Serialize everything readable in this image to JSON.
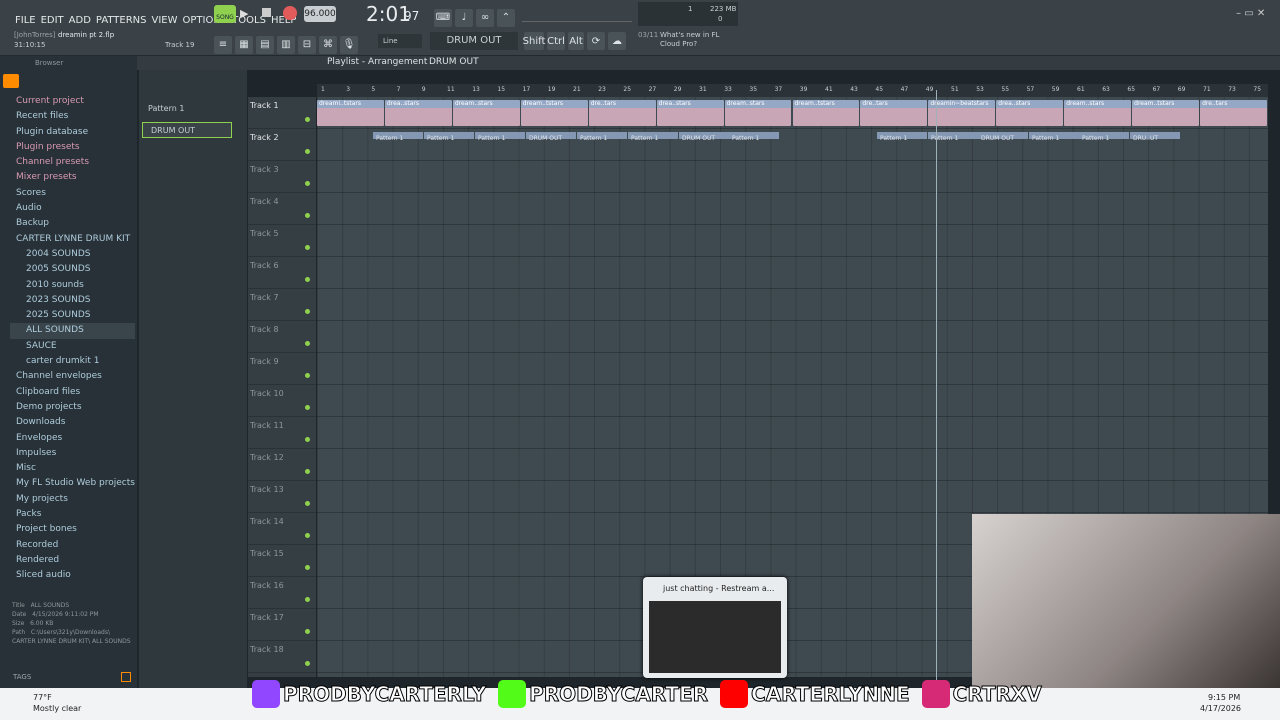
{
  "menu": [
    "FILE",
    "EDIT",
    "ADD",
    "PATTERNS",
    "VIEW",
    "OPTIONS",
    "TOOLS",
    "HELP"
  ],
  "transport": {
    "mode": "SONG",
    "tempo": "96.000",
    "time": "2:01",
    "time_ms": "97",
    "cpu": "1",
    "mem": "223 MB",
    "poly": "0"
  },
  "hint": {
    "author": "[JohnTorres]",
    "file": "dreamin pt 2.flp",
    "pos": "31:10:15",
    "track": "Track 19"
  },
  "snap": "Line",
  "pattern_name": "DRUM OUT",
  "keys": [
    "Shift",
    "Ctrl",
    "Alt"
  ],
  "news": {
    "count": "03/11",
    "text": "What's new in FL Cloud Pro?"
  },
  "browser": {
    "title": "Browser",
    "items": [
      "Current project",
      "Recent files",
      "Plugin database",
      "Plugin presets",
      "Channel presets",
      "Mixer presets",
      "Scores",
      "Audio",
      "Backup",
      "CARTER LYNNE DRUM KIT",
      "2004 SOUNDS",
      "2005 SOUNDS",
      "2010 sounds",
      "2023 SOUNDS",
      "2025 SOUNDS",
      "ALL SOUNDS",
      "SAUCE",
      "carter drumkit 1",
      "Channel envelopes",
      "Clipboard files",
      "Demo projects",
      "Downloads",
      "Envelopes",
      "Impulses",
      "Misc",
      "My FL Studio Web projects",
      "My projects",
      "Packs",
      "Project bones",
      "Recorded",
      "Rendered",
      "Sliced audio"
    ],
    "info": {
      "title_label": "Title",
      "title": "ALL SOUNDS",
      "date_label": "Date",
      "date": "4/15/2026 9:11:02 PM",
      "size_label": "Size",
      "size": "6.00 KB",
      "path_label": "Path",
      "path": "C:\\Users\\321y\\Downloads\\ CARTER LYNNE DRUM KIT\\ ALL SOUNDS"
    },
    "tags": "TAGS"
  },
  "playlist": {
    "title": "Playlist - Arrangement",
    "pattern": "DRUM OUT",
    "patterns": [
      "Pattern 1",
      "DRUM OUT"
    ],
    "ruler": [
      "1",
      "3",
      "5",
      "7",
      "9",
      "11",
      "13",
      "15",
      "17",
      "19",
      "21",
      "23",
      "25",
      "27",
      "29",
      "31",
      "33",
      "35",
      "37",
      "39",
      "41",
      "43",
      "45",
      "47",
      "49",
      "51",
      "53",
      "55",
      "57",
      "59",
      "61",
      "63",
      "65",
      "67",
      "69",
      "71",
      "73",
      "75"
    ],
    "tracks": [
      "Track 1",
      "Track 2",
      "Track 3",
      "Track 4",
      "Track 5",
      "Track 6",
      "Track 7",
      "Track 8",
      "Track 9",
      "Track 10",
      "Track 11",
      "Track 12",
      "Track 13",
      "Track 14",
      "Track 15",
      "Track 16",
      "Track 17",
      "Track 18"
    ],
    "audio_clips": [
      "dreami..tstars",
      "drea..stars",
      "dream..stars",
      "dream..tstars",
      "dre..tars",
      "drea..stars",
      "dream..stars",
      "dream..tstars",
      "dre..tars",
      "dreamin~beatstars",
      "drea..stars",
      "dream..stars",
      "dream..tstars",
      "dre..tars"
    ],
    "pattern_clips": [
      "Pattern 1",
      "Pattern 1",
      "Pattern 1",
      "DRUM OUT",
      "Pattern 1",
      "Pattern 1",
      "DRUM OUT",
      "Pattern 1",
      "Pattern 1",
      "Pattern 1",
      "DRUM OUT",
      "Pattern 1",
      "Pattern 1",
      "DRU..UT"
    ]
  },
  "popup": {
    "title": "just chatting - Restream a..."
  },
  "socials": [
    {
      "handle": "PRODBYCARTERLY",
      "color": "#9146ff"
    },
    {
      "handle": "PRODBYCARTER",
      "color": "#53fc18"
    },
    {
      "handle": "CARTERLYNNE",
      "color": "#ff0000"
    },
    {
      "handle": "CRTRXV",
      "color": "#d62976"
    }
  ],
  "weather": {
    "temp": "77°F",
    "desc": "Mostly clear"
  },
  "clock": {
    "time": "9:15 PM",
    "date": "4/17/2026"
  }
}
